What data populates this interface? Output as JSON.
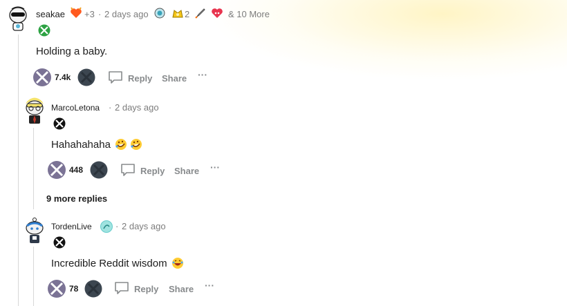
{
  "colors": {
    "xbox_green": "#2ca243",
    "vote_purple": "#7b7395",
    "dark_circle": "#3c4650",
    "muted": "#878a8c",
    "link_blue": "#0079d3"
  },
  "comments": [
    {
      "username": "seakae",
      "award_bonus": "+3",
      "time": "2 days ago",
      "award_count": "2",
      "more_awards": "& 10 More",
      "flair_icon": "xbox-logo-green",
      "body": "Holding a baby.",
      "votes": "7.4k",
      "reply_label": "Reply",
      "share_label": "Share",
      "more_label": "···"
    },
    {
      "username": "MarcoLetona",
      "time": "2 days ago",
      "flair_icon": "xbox-logo-black",
      "body": "Hahahahaha",
      "emojis": [
        "rofl-emoji",
        "rofl-emoji"
      ],
      "votes": "448",
      "reply_label": "Reply",
      "share_label": "Share",
      "more_label": "···",
      "more_replies": "9 more replies"
    },
    {
      "username": "TordenLive",
      "time": "2 days ago",
      "flair_icon": "xbox-logo-black",
      "body": "Incredible Reddit wisdom",
      "emojis": [
        "laughing-emoji"
      ],
      "votes": "78",
      "reply_label": "Reply",
      "share_label": "Share",
      "more_label": "···"
    }
  ],
  "separator": "·"
}
